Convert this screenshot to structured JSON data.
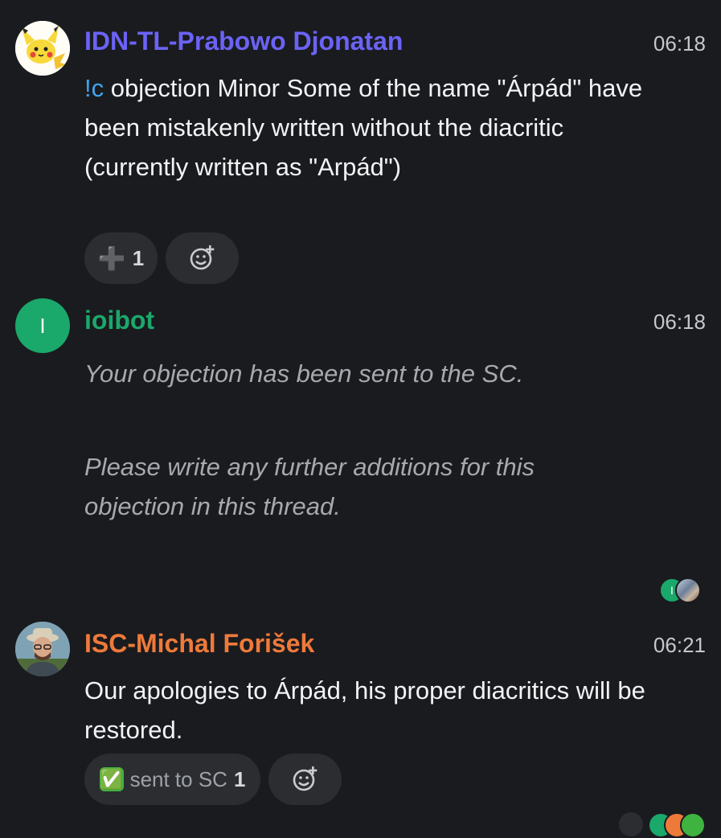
{
  "messages": [
    {
      "sender": "IDN-TL-Prabowo Djonatan",
      "sender_color": "#6b63f5",
      "time": "06:18",
      "command": "!c",
      "text": " objection Minor Some of the name \"Árpád\" have been mistakenly written without the diacritic (currently written as \"Arpád\")",
      "reactions": [
        {
          "emoji": "➕",
          "count": "1"
        }
      ]
    },
    {
      "sender": "ioibot",
      "sender_color": "#1aa86b",
      "avatar_letter": "I",
      "time": "06:18",
      "line1": "Your objection has been sent to the SC.",
      "line2": "Please write any further additions for this objection in this thread."
    },
    {
      "sender": "ISC-Michal Forišek",
      "sender_color": "#ee7a3a",
      "time": "06:21",
      "text": "Our apologies to Árpád, his proper diacritics will be restored.",
      "reactions": [
        {
          "emoji": "✅",
          "label": "sent to SC",
          "count": "1"
        }
      ]
    }
  ],
  "read_receipts": {
    "avatar_letter": "I"
  },
  "colors": {
    "background": "#1a1b1f",
    "chip": "#2b2d31",
    "command": "#3ea6f0"
  }
}
